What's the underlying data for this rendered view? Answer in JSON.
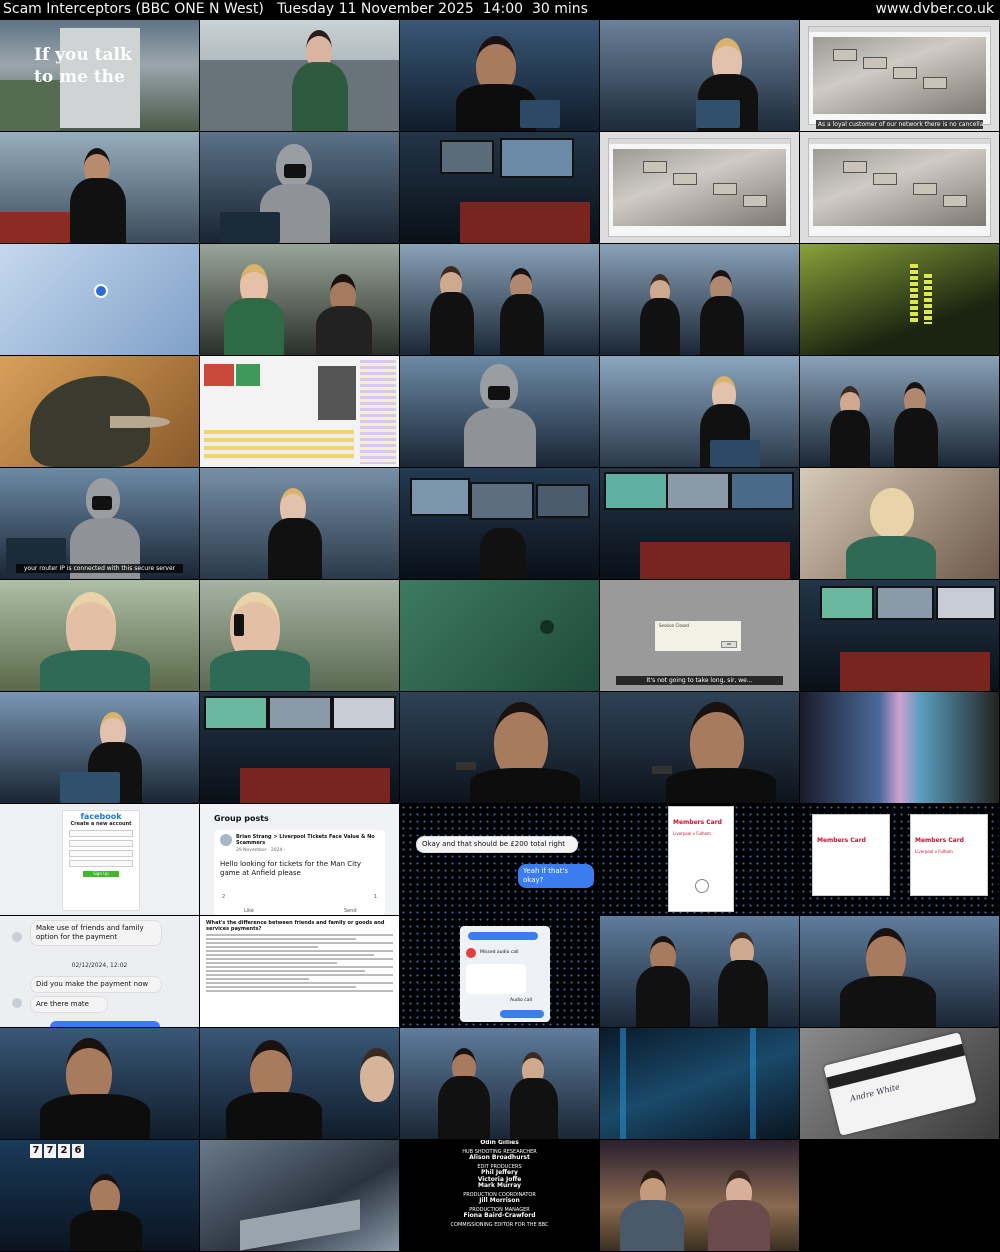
{
  "header": {
    "title": "Scam Interceptors (BBC ONE N West)",
    "date": "Tuesday 11 November 2025",
    "time": "14:00",
    "duration": "30 mins",
    "site": "www.dvber.co.uk"
  },
  "captions": {
    "opening_text": "If you talk to me the",
    "loyal_customer": "As a loyal customer of our network there is no cancellation fee...",
    "router_ip": "your router IP is connected with this secure server",
    "not_long": "It's not going to take long, sir, we..."
  },
  "screen_text": {
    "session_closed": "Session Closed",
    "facebook": {
      "logo": "facebook",
      "heading": "Create a new account",
      "button": "Sign Up"
    },
    "group_posts": {
      "heading": "Group posts",
      "author": "Brian Strang > Liverpool Tickets Face Value & No Scammers",
      "date": "29 November · 2024 ·",
      "post": "Hello looking for tickets for the Man City game at Anfield please",
      "reactions": "2",
      "comments": "1",
      "like": "Like",
      "send": "Send"
    },
    "chat1": {
      "in": "Okay and that should be £200 total right",
      "out": "Yeah if that's okay?"
    },
    "members_card": {
      "title": "Members Card",
      "match": "Liverpool v Fulham"
    },
    "chat2": {
      "in1": "Make use of friends and family option for the payment",
      "timestamp": "02/12/2024, 12:02",
      "in2": "Did you make the payment now",
      "in3": "Are there mate"
    },
    "article_heading": "What's the difference between friends and family or goods and services payments?",
    "missed_call": "Missed audio call",
    "audio_call": "Audio call",
    "card_signature": "Andre White",
    "countdown": [
      "7",
      "7",
      "2",
      "6"
    ]
  },
  "credits": {
    "lines": [
      {
        "role": "",
        "name": "Odin Gillies"
      },
      {
        "role": "HUB SHOOTING RESEARCHER",
        "name": "Alison Broadhurst"
      },
      {
        "role": "EDIT PRODUCERS",
        "name": "Phil Jeffery"
      },
      {
        "role": "",
        "name": "Victoria Joffe"
      },
      {
        "role": "",
        "name": "Mark Murray"
      },
      {
        "role": "PRODUCTION COORDINATOR",
        "name": "Jill Morrison"
      },
      {
        "role": "PRODUCTION MANAGER",
        "name": "Fiona Baird-Crawford"
      },
      {
        "role": "COMMISSIONING EDITOR FOR THE BBC",
        "name": ""
      }
    ]
  },
  "colors": {
    "header_bg": "#000000",
    "header_text": "#f5f5f5",
    "office_blue": "#1f3a55",
    "accent_blue": "#3b7df0",
    "liverpool_red": "#c8102e"
  }
}
